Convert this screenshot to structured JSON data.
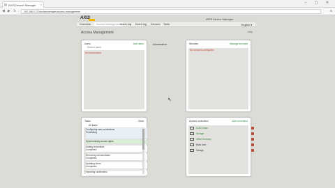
{
  "browser": {
    "tab_title": "AXIS Device Manager",
    "tab_close": "×",
    "window_controls": "– ▢ ✕",
    "back": "◀",
    "forward": "▶",
    "reload": "↻",
    "address": "192.168.0.12/devicemanager/access-management",
    "menu": "≡"
  },
  "app": {
    "logo": "AXIS",
    "title": "AXIS Device Manager",
    "nav": [
      "Overview",
      "Access Management",
      "Alarm log",
      "Event log",
      "Devices",
      "Tools"
    ],
    "language": "English ▾"
  },
  "page": {
    "title": "Access Management",
    "help": "Help",
    "information_label": "Information"
  },
  "panels": {
    "top_left": {
      "header": "Users",
      "action": "Add users",
      "search": "Search users",
      "alert": "No users found"
    },
    "top_right": {
      "header": "Services",
      "action": "Manage services",
      "alert": "No services configured"
    },
    "bottom_left": {
      "header": "Tasks",
      "action": "Clear",
      "filter": "All tasks",
      "tasks": [
        {
          "line1": "Configuring user permissions",
          "line2": "Processing",
          "state": "info"
        },
        {
          "line1": "Synchronizing access rights",
          "line2": "Completed",
          "state": "ok"
        },
        {
          "line1": "Adding credentials",
          "line2": "Completed",
          "state": "ok"
        },
        {
          "line1": "Removing old schedules",
          "line2": "Completed",
          "state": "ok"
        },
        {
          "line1": "Updating doors",
          "line2": "Completed",
          "state": "ok"
        },
        {
          "line1": "Importing cardholders",
          "line2": "Completed",
          "state": "ok"
        }
      ]
    },
    "bottom_right": {
      "header": "Access controllers",
      "action": "Add controllers",
      "items": [
        {
          "label": "A1001 Main"
        },
        {
          "label": "Storage"
        },
        {
          "label": "Office Entrance"
        },
        {
          "label": "Back door"
        },
        {
          "label": "Garage"
        }
      ]
    }
  },
  "colors": {
    "page_bg": "#dddbd6",
    "alert": "#c0392b",
    "ok": "#2a8a3a",
    "brand": "#f5b800"
  }
}
